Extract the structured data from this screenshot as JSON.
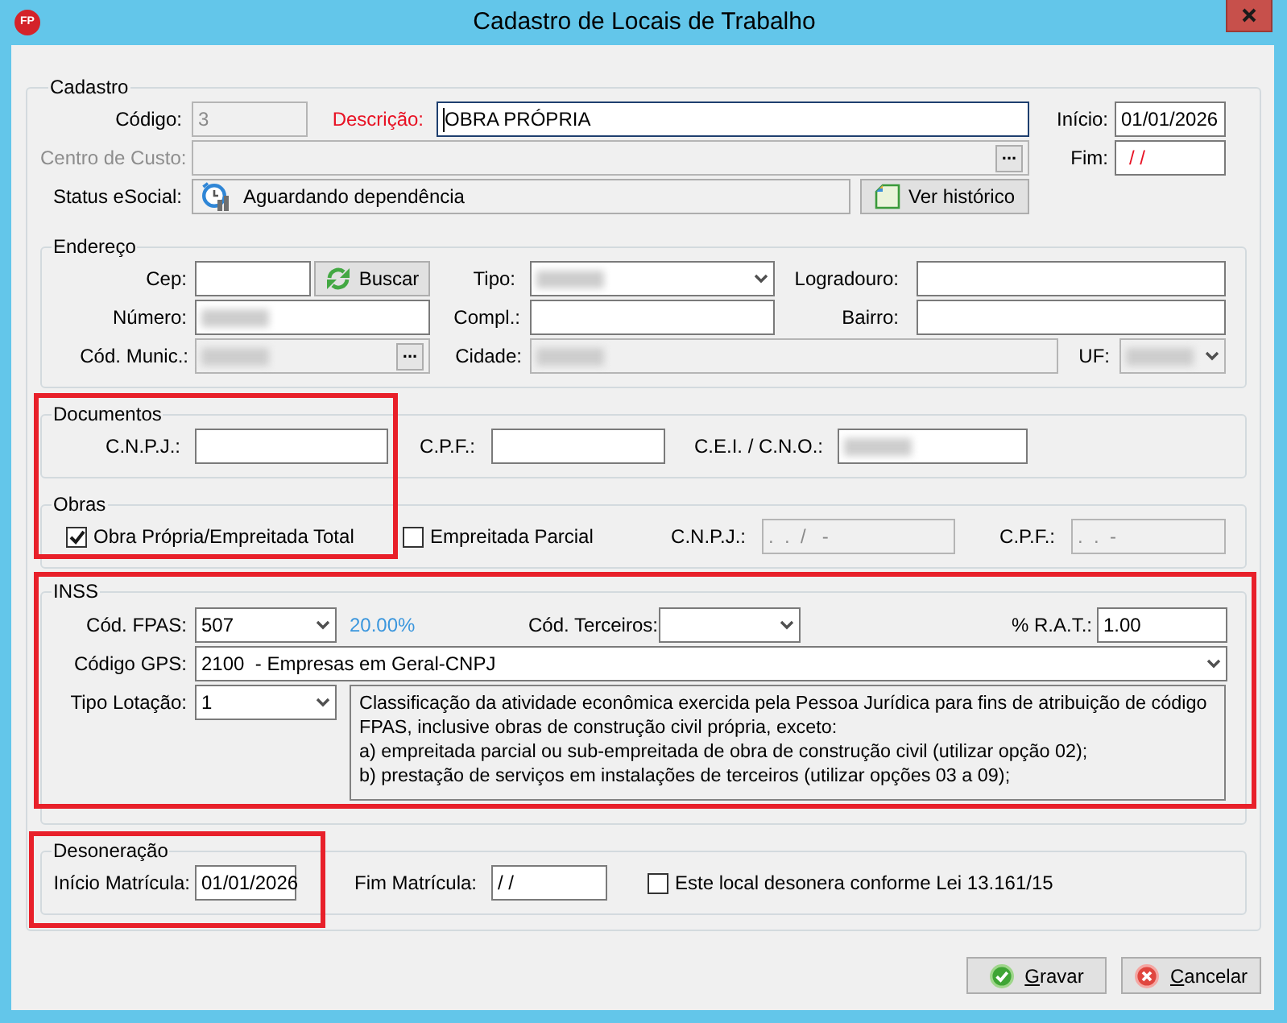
{
  "window": {
    "title": "Cadastro de Locais de Trabalho",
    "icon_text": "FP"
  },
  "cadastro": {
    "legend": "Cadastro",
    "codigo": {
      "label": "Código:",
      "kind": "text",
      "value": "3",
      "disabled": true
    },
    "descricao": {
      "label": "Descrição:",
      "kind": "text",
      "value": "OBRA PRÓPRIA",
      "disabled": false,
      "required": true,
      "focused": true
    },
    "inicio": {
      "label": "Início:",
      "kind": "text",
      "value": "01/01/2026",
      "disabled": false
    },
    "centro_custo": {
      "label": "Centro de Custo:",
      "kind": "lookup",
      "lookup_button": "...",
      "disabled": true,
      "label_disabled": true
    },
    "fim": {
      "label": "Fim:",
      "kind": "text",
      "value": "/ /",
      "disabled": false,
      "invalid": true
    },
    "status_esocial": {
      "label": "Status eSocial:",
      "kind": "status",
      "value": "Aguardando dependência"
    },
    "historico_button": {
      "label": "Ver histórico"
    }
  },
  "endereco": {
    "legend": "Endereço",
    "cep": {
      "label": "Cep:",
      "kind": "text",
      "disabled": false
    },
    "buscar_button": {
      "label": "Buscar"
    },
    "tipo": {
      "label": "Tipo:",
      "kind": "dropdown",
      "disabled": false,
      "redacted": true
    },
    "logradouro": {
      "label": "Logradouro:",
      "kind": "text",
      "disabled": false
    },
    "numero": {
      "label": "Número:",
      "kind": "text",
      "disabled": false,
      "redacted": true
    },
    "compl": {
      "label": "Compl.:",
      "kind": "text",
      "disabled": false
    },
    "bairro": {
      "label": "Bairro:",
      "kind": "text",
      "disabled": false
    },
    "cod_munic": {
      "label": "Cód. Munic.:",
      "kind": "lookup",
      "lookup_button": "...",
      "disabled": true,
      "redacted": true
    },
    "cidade": {
      "label": "Cidade:",
      "kind": "text",
      "disabled": true,
      "redacted": true
    },
    "uf": {
      "label": "UF:",
      "kind": "dropdown",
      "disabled": true,
      "redacted": true
    }
  },
  "documentos": {
    "legend": "Documentos",
    "highlighted": true,
    "cnpj": {
      "label": "C.N.P.J.:",
      "kind": "text",
      "disabled": false
    },
    "cpf": {
      "label": "C.P.F.:",
      "kind": "text",
      "disabled": false
    },
    "cei_cno": {
      "label": "C.E.I. / C.N.O.:",
      "kind": "text",
      "disabled": false,
      "redacted": true
    }
  },
  "obras": {
    "legend": "Obras",
    "options": [
      {
        "label": "Obra Própria/Empreitada Total",
        "checked": true
      },
      {
        "label": "Empreitada Parcial",
        "checked": false
      }
    ],
    "cnpj": {
      "label": "C.N.P.J.:",
      "kind": "text",
      "value": ".  .  /   -",
      "disabled": true
    },
    "cpf": {
      "label": "C.P.F.:",
      "kind": "text",
      "value": ".  .  -",
      "disabled": true
    }
  },
  "inss": {
    "legend": "INSS",
    "highlighted": true,
    "cod_fpas": {
      "label": "Cód. FPAS:",
      "kind": "dropdown",
      "value": "507",
      "disabled": false
    },
    "fpas_rate": "20.00%",
    "cod_terceiros": {
      "label": "Cód. Terceiros:",
      "kind": "dropdown",
      "disabled": false
    },
    "rat": {
      "label": "% R.A.T.:",
      "kind": "text",
      "value": "1.00",
      "disabled": false
    },
    "codigo_gps": {
      "label": "Código GPS:",
      "kind": "dropdown",
      "value": "2100  - Empresas em Geral-CNPJ",
      "disabled": false
    },
    "tipo_lotacao": {
      "label": "Tipo Lotação:",
      "kind": "dropdown",
      "value": "1",
      "disabled": false
    },
    "lotacao_description": "Classificação da atividade econômica exercida pela Pessoa Jurídica para fins de atribuição de código\nFPAS, inclusive obras de construção civil própria, exceto:\na) empreitada parcial ou sub-empreitada de obra de construção civil (utilizar opção 02);\nb) prestação de serviços em instalações de terceiros (utilizar opções 03 a 09);"
  },
  "desoneracao": {
    "legend": "Desoneração",
    "highlighted": true,
    "inicio_matricula": {
      "label": "Início Matrícula:",
      "kind": "text",
      "value": "01/01/2026",
      "disabled": false
    },
    "fim_matricula": {
      "label": "Fim Matrícula:",
      "kind": "text",
      "value": "/ /",
      "disabled": false
    },
    "desonera_option": {
      "label": "Este local desonera conforme Lei 13.161/15",
      "checked": false
    }
  },
  "buttons": [
    {
      "label": "Gravar",
      "kind": "save",
      "mnemonic": true
    },
    {
      "label": "Cancelar",
      "kind": "cancel",
      "mnemonic": true
    }
  ]
}
